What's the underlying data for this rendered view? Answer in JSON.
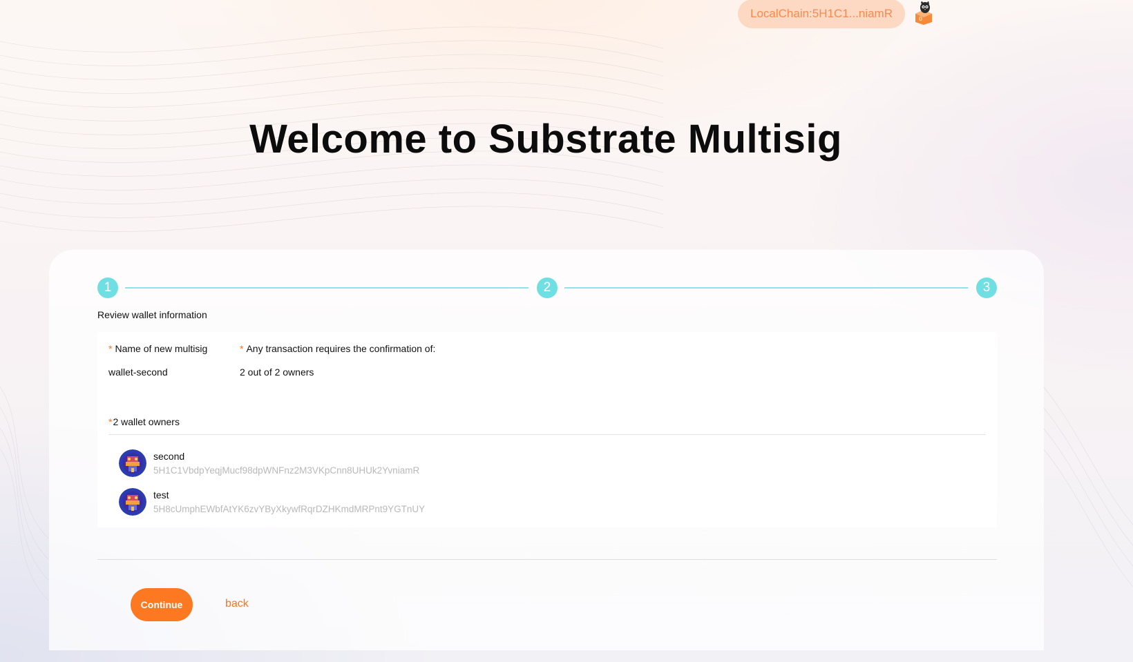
{
  "header": {
    "chain_account": "LocalChain:5H1C1...niamR",
    "extension_icon": "polkadot-extension-icon"
  },
  "page_title": "Welcome to Substrate Multisig",
  "stepper": {
    "steps": [
      "1",
      "2",
      "3"
    ],
    "active_color": "#70dfe3",
    "current_step_caption": "Review wallet information"
  },
  "review": {
    "name_label": "Name of new multisig",
    "name_value": "wallet-second",
    "threshold_label": "Any transaction requires the confirmation of:",
    "threshold_value": "2 out of 2 owners",
    "required_mark": "*",
    "owners_label": "2 wallet owners",
    "owners": [
      {
        "name": "second",
        "address": "5H1C1VbdpYeqjMucf98dpWNFnz2M3VKpCnn8UHUk2YvniamR",
        "avatar_icon": "identicon-avatar"
      },
      {
        "name": "test",
        "address": "5H8cUmphEWbfAtYK6zvYByXkywfRqrDZHKmdMRPnt9YGTnUY",
        "avatar_icon": "identicon-avatar"
      }
    ]
  },
  "actions": {
    "continue_label": "Continue",
    "back_label": "back"
  },
  "colors": {
    "accent": "#fc7921",
    "chain_pill_bg": "#fdd8c2",
    "chain_pill_text": "#f98a4c",
    "step": "#70dfe3",
    "address_text": "#b9b9b9"
  }
}
